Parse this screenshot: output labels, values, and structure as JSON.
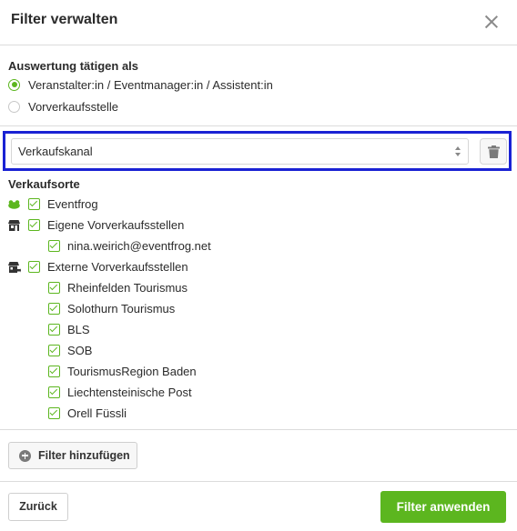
{
  "dialog": {
    "title": "Filter verwalten"
  },
  "evaluation": {
    "label": "Auswertung tätigen als",
    "options": [
      {
        "label": "Veranstalter:in / Eventmanager:in / Assistent:in",
        "selected": true
      },
      {
        "label": "Vorverkaufsstelle",
        "selected": false
      }
    ]
  },
  "filter": {
    "select_value": "Verkaufskanal"
  },
  "sales_points": {
    "title": "Verkaufsorte",
    "groups": [
      {
        "label": "Eventfrog",
        "icon": "frog-icon",
        "checked": true
      },
      {
        "label": "Eigene Vorverkaufsstellen",
        "icon": "store-icon",
        "checked": true,
        "children": [
          {
            "label": "nina.weirich@eventfrog.net",
            "checked": true
          }
        ]
      },
      {
        "label": "Externe Vorverkaufsstellen",
        "icon": "store-external-icon",
        "checked": true,
        "children": [
          {
            "label": "Rheinfelden Tourismus",
            "checked": true
          },
          {
            "label": "Solothurn Tourismus",
            "checked": true
          },
          {
            "label": "BLS",
            "checked": true
          },
          {
            "label": "SOB",
            "checked": true
          },
          {
            "label": "TourismusRegion Baden",
            "checked": true
          },
          {
            "label": "Liechtensteinische Post",
            "checked": true
          },
          {
            "label": "Orell Füssli",
            "checked": true
          }
        ]
      }
    ]
  },
  "buttons": {
    "add_filter": "Filter hinzufügen",
    "back": "Zurück",
    "apply": "Filter anwenden"
  },
  "colors": {
    "accent": "#5cb61f",
    "focus": "#1a22d4"
  }
}
